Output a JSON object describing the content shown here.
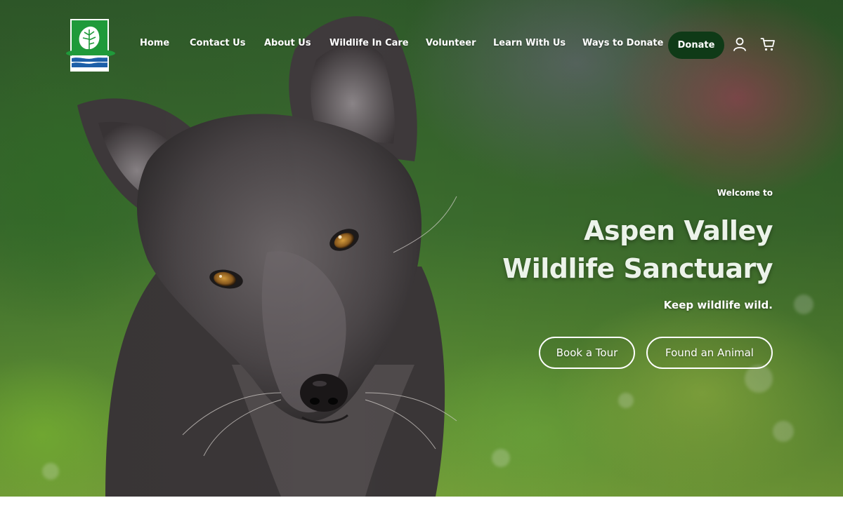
{
  "nav": {
    "items": [
      {
        "label": "Home"
      },
      {
        "label": "Contact Us"
      },
      {
        "label": "About Us"
      },
      {
        "label": "Wildlife In Care"
      },
      {
        "label": "Volunteer"
      },
      {
        "label": "Learn With Us"
      },
      {
        "label": "Ways to Donate"
      }
    ],
    "donate_label": "Donate"
  },
  "header_icons": [
    "logo-leaf-icon",
    "account-icon",
    "cart-icon"
  ],
  "hero": {
    "eyebrow": "Welcome to",
    "title_line1": "Aspen Valley",
    "title_line2": "Wildlife Sanctuary",
    "tagline": "Keep wildlife wild.",
    "primary_button": "Book a Tour",
    "secondary_button": "Found an Animal"
  },
  "colors": {
    "donate_button": "#0f3a17",
    "logo_green": "#1f9a3a",
    "logo_blue": "#1d5fa8",
    "hero_text": "#ecf3ea"
  }
}
